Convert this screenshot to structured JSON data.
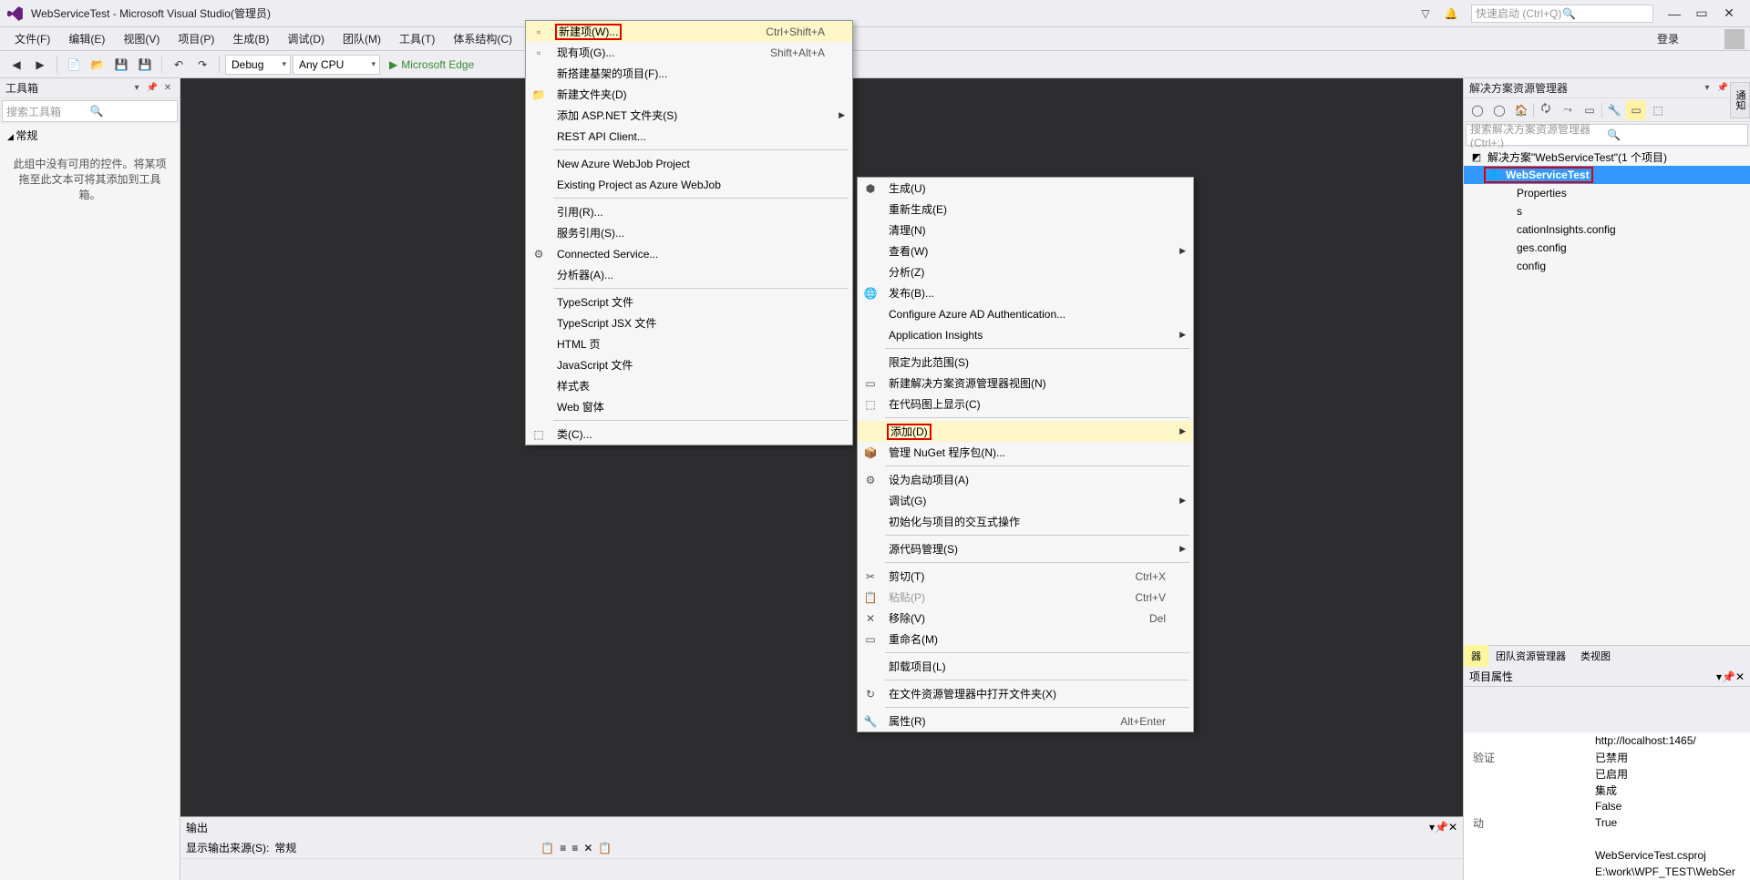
{
  "titlebar": {
    "title": "WebServiceTest - Microsoft Visual Studio(管理员)",
    "quick_launch_placeholder": "快速启动 (Ctrl+Q)"
  },
  "menubar": {
    "items": [
      "文件(F)",
      "编辑(E)",
      "视图(V)",
      "项目(P)",
      "生成(B)",
      "调试(D)",
      "团队(M)",
      "工具(T)",
      "体系结构(C)"
    ],
    "login": "登录"
  },
  "toolbar": {
    "config": "Debug",
    "platform": "Any CPU",
    "run_target": "Microsoft Edge"
  },
  "toolbox": {
    "title": "工具箱",
    "search_placeholder": "搜索工具箱",
    "category": "常规",
    "empty_msg": "此组中没有可用的控件。将某项拖至此文本可将其添加到工具箱。"
  },
  "output": {
    "title": "输出",
    "source_label": "显示输出来源(S):",
    "source_value": "常规"
  },
  "solution_explorer": {
    "title": "解决方案资源管理器",
    "search_placeholder": "搜索解决方案资源管理器(Ctrl+;)",
    "solution": "解决方案\"WebServiceTest\"(1 个项目)",
    "project": "WebServiceTest",
    "items": [
      "Properties",
      "s",
      "cationInsights.config",
      "ges.config",
      "config"
    ],
    "tabs": [
      "器",
      "团队资源管理器",
      "类视图"
    ]
  },
  "properties": {
    "title": "项目属性",
    "rows": [
      {
        "k": "",
        "v": "http://localhost:1465/"
      },
      {
        "k": "验证",
        "v": "已禁用"
      },
      {
        "k": "",
        "v": "已启用"
      },
      {
        "k": "",
        "v": "集成"
      },
      {
        "k": "",
        "v": "False"
      },
      {
        "k": "动",
        "v": "True"
      },
      {
        "k": "",
        "v": ""
      },
      {
        "k": "",
        "v": "WebServiceTest.csproj"
      },
      {
        "k": "",
        "v": "E:\\work\\WPF_TEST\\WebSer"
      }
    ]
  },
  "side_tab": "通知",
  "context_menu_add": {
    "items": [
      {
        "label": "新建项(W)...",
        "shortcut": "Ctrl+Shift+A",
        "icon": "new-item",
        "hl": "red"
      },
      {
        "label": "现有项(G)...",
        "shortcut": "Shift+Alt+A",
        "icon": "existing-item"
      },
      {
        "label": "新搭建基架的项目(F)..."
      },
      {
        "label": "新建文件夹(D)",
        "icon": "folder"
      },
      {
        "label": "添加 ASP.NET 文件夹(S)",
        "arrow": true
      },
      {
        "label": "REST API Client..."
      },
      {
        "sep": true
      },
      {
        "label": "New Azure WebJob Project"
      },
      {
        "label": "Existing Project as Azure WebJob"
      },
      {
        "sep": true
      },
      {
        "label": "引用(R)..."
      },
      {
        "label": "服务引用(S)..."
      },
      {
        "label": "Connected Service...",
        "icon": "connected"
      },
      {
        "label": "分析器(A)..."
      },
      {
        "sep": true
      },
      {
        "label": "TypeScript 文件"
      },
      {
        "label": "TypeScript JSX 文件"
      },
      {
        "label": "HTML 页"
      },
      {
        "label": "JavaScript 文件"
      },
      {
        "label": "样式表"
      },
      {
        "label": "Web 窗体"
      },
      {
        "sep": true
      },
      {
        "label": "类(C)...",
        "icon": "class"
      }
    ]
  },
  "context_menu_project": {
    "items": [
      {
        "label": "生成(U)",
        "icon": "build"
      },
      {
        "label": "重新生成(E)"
      },
      {
        "label": "清理(N)"
      },
      {
        "label": "查看(W)",
        "arrow": true
      },
      {
        "label": "分析(Z)"
      },
      {
        "label": "发布(B)...",
        "icon": "publish"
      },
      {
        "label": "Configure Azure AD Authentication..."
      },
      {
        "label": "Application Insights",
        "arrow": true
      },
      {
        "sep": true
      },
      {
        "label": "限定为此范围(S)"
      },
      {
        "label": "新建解决方案资源管理器视图(N)",
        "icon": "new-view"
      },
      {
        "label": "在代码图上显示(C)",
        "icon": "codemap"
      },
      {
        "sep": true
      },
      {
        "label": "添加(D)",
        "arrow": true,
        "hl": "red"
      },
      {
        "label": "管理 NuGet 程序包(N)...",
        "icon": "nuget"
      },
      {
        "sep": true
      },
      {
        "label": "设为启动项目(A)",
        "icon": "startup"
      },
      {
        "label": "调试(G)",
        "arrow": true
      },
      {
        "label": "初始化与项目的交互式操作"
      },
      {
        "sep": true
      },
      {
        "label": "源代码管理(S)",
        "arrow": true
      },
      {
        "sep": true
      },
      {
        "label": "剪切(T)",
        "shortcut": "Ctrl+X",
        "icon": "cut"
      },
      {
        "label": "粘贴(P)",
        "shortcut": "Ctrl+V",
        "icon": "paste",
        "disabled": true
      },
      {
        "label": "移除(V)",
        "shortcut": "Del",
        "icon": "remove"
      },
      {
        "label": "重命名(M)",
        "icon": "rename"
      },
      {
        "sep": true
      },
      {
        "label": "卸载项目(L)"
      },
      {
        "sep": true
      },
      {
        "label": "在文件资源管理器中打开文件夹(X)",
        "icon": "open-folder"
      },
      {
        "sep": true
      },
      {
        "label": "属性(R)",
        "shortcut": "Alt+Enter",
        "icon": "properties"
      }
    ]
  }
}
